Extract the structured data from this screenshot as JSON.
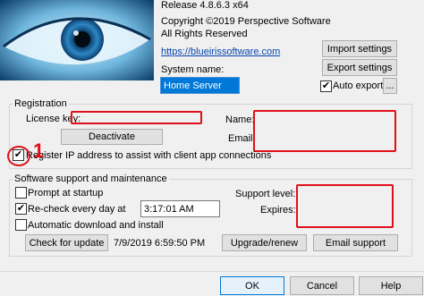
{
  "about": {
    "release": "Release 4.8.6.3 x64",
    "copyright": "Copyright ©2019 Perspective Software",
    "rights": "All Rights Reserved",
    "website": "https://blueirissoftware.com",
    "system_name_label": "System name:",
    "system_name_value": "Home Server"
  },
  "settings_buttons": {
    "import": "Import settings",
    "export": "Export settings",
    "auto_export_label": "Auto export",
    "auto_export_checked": true,
    "browse": "..."
  },
  "registration": {
    "group_label": "Registration",
    "license_key_label": "License key:",
    "name_label": "Name:",
    "email_label": "Email:",
    "deactivate": "Deactivate",
    "register_ip_label": "Register IP address to assist with client app connections",
    "register_ip_checked": true,
    "annotation": "1"
  },
  "support": {
    "group_label": "Software support and maintenance",
    "prompt_startup_label": "Prompt at startup",
    "prompt_startup_checked": false,
    "recheck_label": "Re-check every day at",
    "recheck_checked": true,
    "recheck_time": "3:17:01 AM",
    "auto_download_label": "Automatic download and install",
    "auto_download_checked": false,
    "check_update": "Check for update",
    "last_check": "7/9/2019 6:59:50 PM",
    "support_level_label": "Support level:",
    "expires_label": "Expires:",
    "upgrade": "Upgrade/renew",
    "email_support": "Email support"
  },
  "dialog_buttons": {
    "ok": "OK",
    "cancel": "Cancel",
    "help": "Help"
  },
  "colors": {
    "highlight": "#e0101a",
    "link": "#0645ad",
    "selection": "#0078d7"
  },
  "icons": {
    "logo": "blue-eye-logo"
  }
}
